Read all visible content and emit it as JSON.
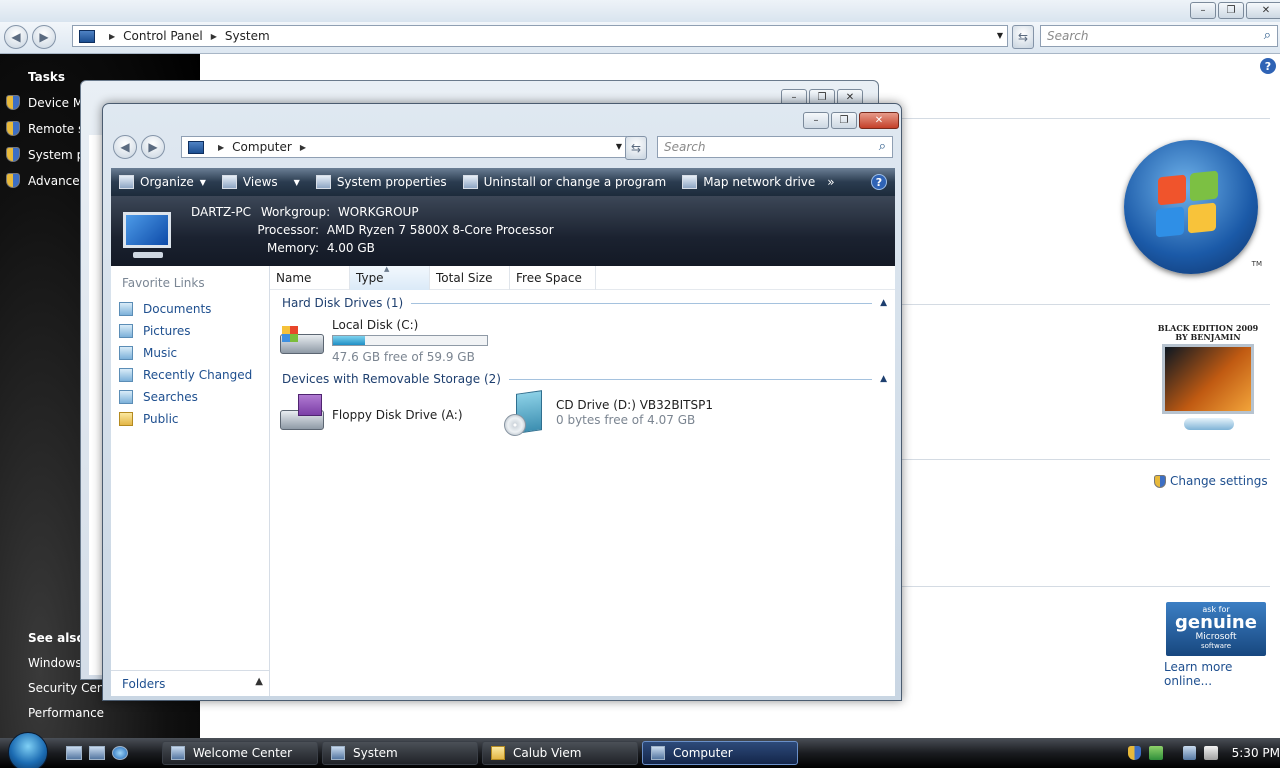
{
  "system_window": {
    "breadcrumb": [
      "Control Panel",
      "System"
    ],
    "search_placeholder": "Search",
    "sidebar": {
      "tasks_heading": "Tasks",
      "tasks": [
        "Device Ma",
        "Remote se",
        "System pr",
        "Advanced"
      ],
      "see_also_heading": "See also",
      "see_also": [
        "Windows",
        "Security Center",
        "Performance"
      ]
    },
    "oem_logo_text": "BLACK EDITION 2009 BY BENJAMIN",
    "windows_logo_tm": "TM",
    "change_settings": "Change settings",
    "genuine": {
      "line1": "ask for",
      "line2": "genuine",
      "line3": "Microsoft",
      "line4": "software"
    },
    "learn_more": "Learn more online..."
  },
  "computer_window": {
    "breadcrumb": "Computer",
    "search_placeholder": "Search",
    "toolbar": {
      "organize": "Organize",
      "views": "Views",
      "system_properties": "System properties",
      "uninstall": "Uninstall or change a program",
      "map_network": "Map network drive",
      "more": "»"
    },
    "details": {
      "pc_name": "DARTZ-PC",
      "workgroup_label": "Workgroup:",
      "workgroup_value": "WORKGROUP",
      "processor_label": "Processor:",
      "processor_value": "AMD Ryzen 7 5800X 8-Core Processor",
      "memory_label": "Memory:",
      "memory_value": "4.00 GB"
    },
    "nav": {
      "heading": "Favorite Links",
      "items": [
        "Documents",
        "Pictures",
        "Music",
        "Recently Changed",
        "Searches",
        "Public"
      ],
      "folders": "Folders"
    },
    "columns": [
      "Name",
      "Type",
      "Total Size",
      "Free Space"
    ],
    "groups": {
      "hard_disks": "Hard Disk Drives (1)",
      "removable": "Devices with Removable Storage (2)"
    },
    "drives": {
      "local": {
        "name": "Local Disk (C:)",
        "free": "47.6 GB free of 59.9 GB",
        "used_fraction": 0.205
      },
      "floppy": {
        "name": "Floppy Disk Drive (A:)"
      },
      "cd": {
        "name": "CD Drive (D:) VB32BITSP1",
        "free": "0 bytes free of 4.07 GB"
      }
    }
  },
  "taskbar": {
    "buttons": [
      "Welcome Center",
      "System",
      "Calub Viem",
      "Computer"
    ],
    "active": "Computer",
    "clock": "5:30 PM"
  }
}
